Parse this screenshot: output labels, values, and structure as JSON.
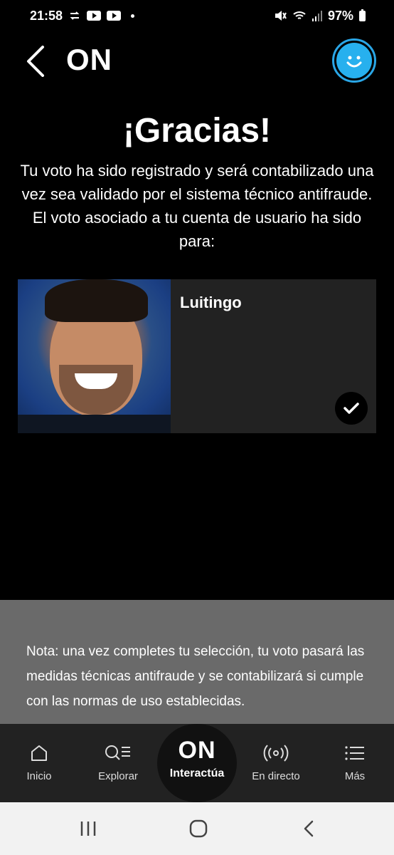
{
  "status_bar": {
    "time": "21:58",
    "battery": "97%",
    "icons": [
      "sync-icon",
      "youtube-icon",
      "youtube-icon",
      "dot-icon",
      "mute-icon",
      "wifi-icon",
      "signal-icon",
      "battery-icon"
    ]
  },
  "header": {
    "brand": "ON",
    "back_icon": "chevron-left-icon",
    "avatar_icon": "smiley-icon",
    "accent_color": "#27b0ee"
  },
  "main": {
    "title": "¡Gracias!",
    "description": "Tu voto ha sido registrado y será contabilizado una vez sea validado por el sistema técnico antifraude. El voto asociado a tu cuenta de usuario ha sido para:",
    "selection": {
      "name": "Luitingo",
      "selected_icon": "check-icon"
    }
  },
  "note": {
    "text": "Nota: una vez completes tu selección, tu voto pasará las medidas técnicas antifraude y se contabilizará si cumple con las normas de uso establecidas."
  },
  "bottom_nav": {
    "items": [
      {
        "label": "Inicio",
        "icon": "home-icon"
      },
      {
        "label": "Explorar",
        "icon": "search-list-icon"
      },
      {
        "label": "Interactúa",
        "icon": "on-logo",
        "logo_text": "ON",
        "active": true
      },
      {
        "label": "En directo",
        "icon": "broadcast-icon"
      },
      {
        "label": "Más",
        "icon": "menu-list-icon"
      }
    ]
  },
  "system_nav": {
    "icons": [
      "recents-icon",
      "home-circle-icon",
      "back-icon"
    ]
  }
}
